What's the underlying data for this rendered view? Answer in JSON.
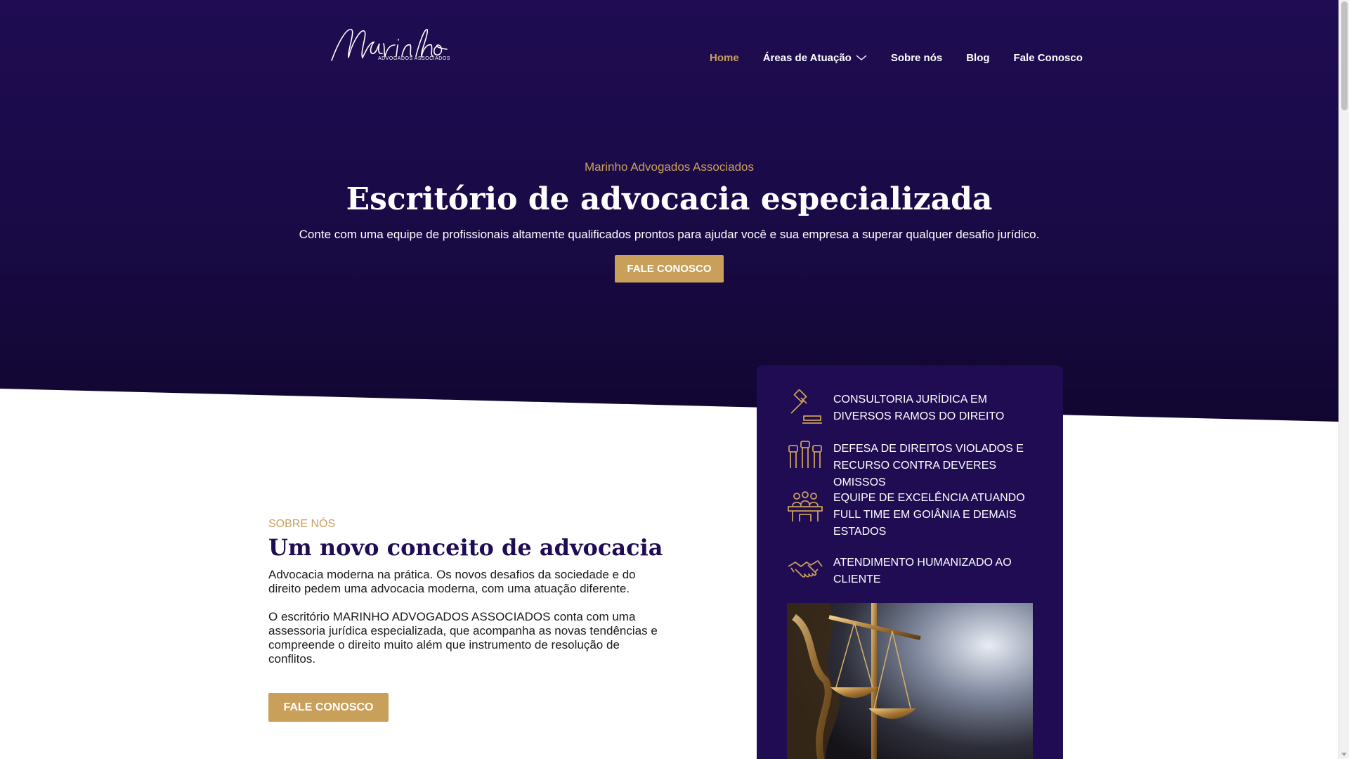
{
  "header": {
    "logo": {
      "script": "Marinho",
      "tagline": "ADVOGADOS ASSOCIADOS"
    },
    "nav": [
      {
        "label": "Home",
        "active": true
      },
      {
        "label": "Áreas de Atuação",
        "dropdown": true
      },
      {
        "label": "Sobre nós"
      },
      {
        "label": "Blog"
      },
      {
        "label": "Fale Conosco"
      }
    ]
  },
  "hero": {
    "eyebrow": "Marinho Advogados Associados",
    "title": "Escritório de advocacia especializada",
    "subtitle": "Conte com uma equipe de profissionais altamente qualificados prontos para ajudar você e sua empresa a superar qualquer desafio jurídico.",
    "cta_label": "FALE CONOSCO"
  },
  "about": {
    "eyebrow": "SOBRE NÓS",
    "title": "Um novo conceito de advocacia",
    "paragraph1": "Advocacia moderna na prática. Os novos desafios da sociedade e do direito pedem uma advocacia moderna, com uma atuação diferente.",
    "paragraph2": "O escritório MARINHO ADVOGADOS ASSOCIADOS conta com uma assessoria jurídica especializada, que acompanha as novas tendências e compreende o direito muito além que instrumento de resolução de conflitos.",
    "cta_label": "FALE CONOSCO"
  },
  "features": [
    {
      "icon": "gavel-icon",
      "text": "CONSULTORIA JURÍDICA EM DIVERSOS RAMOS DO DIREITO"
    },
    {
      "icon": "raised-fists-icon",
      "text": "DEFESA DE DIREITOS VIOLADOS E RECURSO CONTRA DEVERES OMISSOS"
    },
    {
      "icon": "team-table-icon",
      "text": "EQUIPE DE EXCELÊNCIA ATUANDO FULL TIME EM GOIÂNIA E DEMAIS ESTADOS"
    },
    {
      "icon": "handshake-icon",
      "text": "ATENDIMENTO HUMANIZADO AO CLIENTE"
    }
  ],
  "colors": {
    "navy": "#1f0c52",
    "gold": "#c9a05a",
    "white": "#ffffff"
  }
}
